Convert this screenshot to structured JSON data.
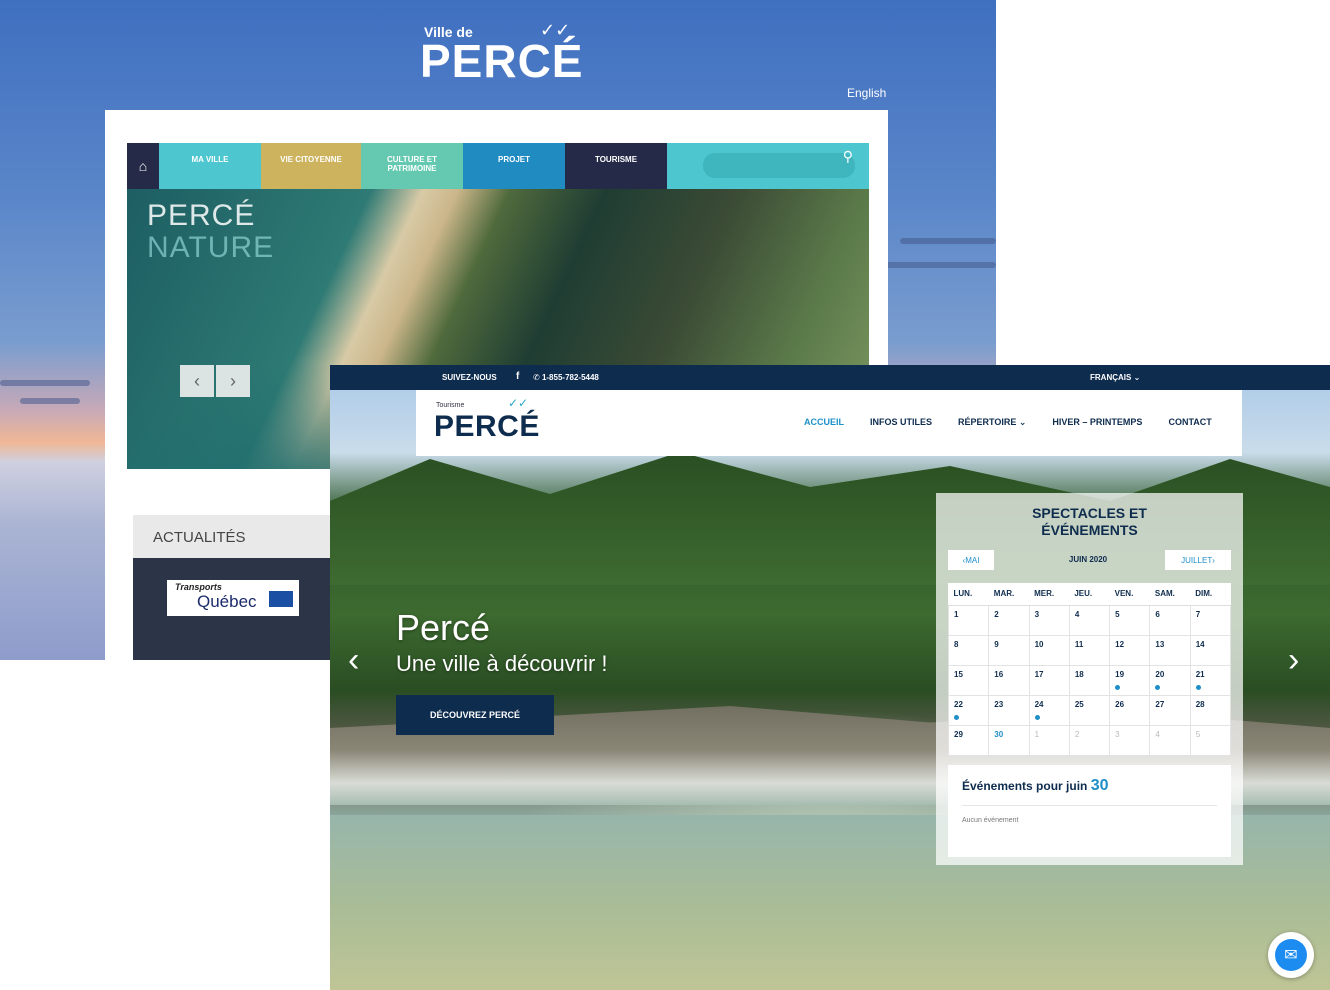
{
  "back_site": {
    "logo_small": "Ville de",
    "logo_main": "PERCÉ",
    "language_link": "English",
    "nav": [
      {
        "label": "MA VILLE",
        "color": "#4ec6cf"
      },
      {
        "label": "VIE CITOYENNE",
        "color": "#cdb35e"
      },
      {
        "label": "CULTURE ET PATRIMOINE",
        "color": "#64c9b0"
      },
      {
        "label": "PROJET",
        "color": "#1f8bc0"
      },
      {
        "label": "TOURISME",
        "color": "#242a48"
      }
    ],
    "hero_title_1": "PERCÉ",
    "hero_title_2": "NATURE",
    "prev_arrow": "‹",
    "next_arrow": "›",
    "news_heading": "ACTUALITÉS",
    "news_logo_line1": "Transports",
    "news_logo_line2": "Québec"
  },
  "front_site": {
    "topbar": {
      "follow_label": "SUIVEZ-NOUS",
      "facebook": "f",
      "phone": "1-855-782-5448",
      "language": "FRANÇAIS"
    },
    "logo_small": "Tourisme",
    "logo_main": "PERCÉ",
    "menu": [
      {
        "label": "ACCUEIL",
        "active": true
      },
      {
        "label": "INFOS UTILES",
        "active": false
      },
      {
        "label": "RÉPERTOIRE",
        "active": false
      },
      {
        "label": "HIVER – PRINTEMPS",
        "active": false
      },
      {
        "label": "CONTACT",
        "active": false
      }
    ],
    "hero_title": "Percé",
    "hero_subtitle": "Une ville à découvrir !",
    "cta_label": "DÉCOUVREZ PERCÉ",
    "calendar": {
      "title": "SPECTACLES ET ÉVÉNEMENTS",
      "prev_label": "MAI",
      "month_label": "JUIN 2020",
      "next_label": "JUILLET",
      "weekdays": [
        "LUN.",
        "MAR.",
        "MER.",
        "JEU.",
        "VEN.",
        "SAM.",
        "DIM."
      ],
      "weeks": [
        [
          "1",
          "2",
          "3",
          "4",
          "5",
          "6",
          "7"
        ],
        [
          "8",
          "9",
          "10",
          "11",
          "12",
          "13",
          "14"
        ],
        [
          "15",
          "16",
          "17",
          "18",
          "19",
          "20",
          "21"
        ],
        [
          "22",
          "23",
          "24",
          "25",
          "26",
          "27",
          "28"
        ],
        [
          "29",
          "30",
          "1",
          "2",
          "3",
          "4",
          "5"
        ]
      ],
      "event_days": [
        "19",
        "20",
        "21",
        "22",
        "24"
      ],
      "events_heading": "Événements pour juin",
      "events_day": "30",
      "no_events": "Aucun événement"
    }
  }
}
